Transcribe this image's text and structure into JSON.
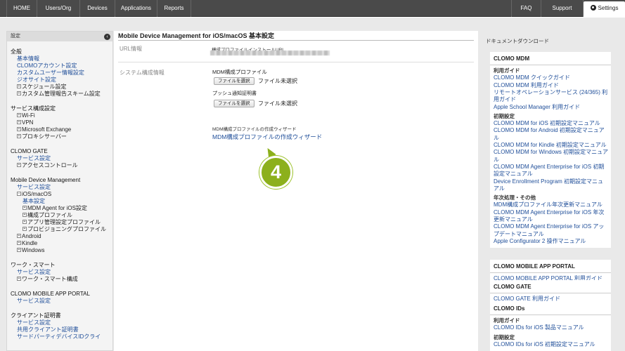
{
  "nav": {
    "items": [
      "HOME",
      "Users/Org",
      "Devices",
      "Applications",
      "Reports"
    ],
    "right_items": [
      "FAQ",
      "Support"
    ],
    "settings_label": "Settings"
  },
  "sidebar": {
    "header": "設定",
    "lines": [
      {
        "text": "全般",
        "kind": "sec",
        "indent": 0
      },
      {
        "text": "基本情報",
        "kind": "lnk",
        "indent": 1
      },
      {
        "text": "CLOMOアカウント設定",
        "kind": "lnk",
        "indent": 1
      },
      {
        "text": "カスタムユーザー情報設定",
        "kind": "lnk",
        "indent": 1
      },
      {
        "text": "ジオサイト設定",
        "kind": "lnk",
        "indent": 1
      },
      {
        "text": "スケジュール設定",
        "kind": "exp",
        "indent": 1
      },
      {
        "text": "カスタム管理報告スキーム設定",
        "kind": "exp",
        "indent": 1
      },
      {
        "text": "サービス構成設定",
        "kind": "sec",
        "indent": 0
      },
      {
        "text": "Wi-Fi",
        "kind": "exp",
        "indent": 1
      },
      {
        "text": "VPN",
        "kind": "exp",
        "indent": 1
      },
      {
        "text": "Microsoft Exchange",
        "kind": "exp",
        "indent": 1
      },
      {
        "text": "プロキシサーバー",
        "kind": "exp",
        "indent": 1
      },
      {
        "text": "CLOMO GATE",
        "kind": "sec",
        "indent": 0
      },
      {
        "text": "サービス設定",
        "kind": "lnk",
        "indent": 1
      },
      {
        "text": "アクセスコントロール",
        "kind": "exp",
        "indent": 1
      },
      {
        "text": "Mobile Device Management",
        "kind": "sec",
        "indent": 0
      },
      {
        "text": "サービス設定",
        "kind": "lnk",
        "indent": 1
      },
      {
        "text": "iOS/macOS",
        "kind": "col",
        "indent": 1
      },
      {
        "text": "基本設定",
        "kind": "lnk",
        "indent": 2
      },
      {
        "text": "MDM Agent for iOS設定",
        "kind": "exp",
        "indent": 2
      },
      {
        "text": "構成プロファイル",
        "kind": "exp",
        "indent": 2
      },
      {
        "text": "アプリ管理設定プロファイル",
        "kind": "exp",
        "indent": 2
      },
      {
        "text": "プロビジョニングプロファイル",
        "kind": "exp",
        "indent": 2
      },
      {
        "text": "Android",
        "kind": "exp",
        "indent": 1
      },
      {
        "text": "Kindle",
        "kind": "exp",
        "indent": 1
      },
      {
        "text": "Windows",
        "kind": "exp",
        "indent": 1
      },
      {
        "text": "ワーク・スマート",
        "kind": "sec",
        "indent": 0
      },
      {
        "text": "サービス設定",
        "kind": "lnk",
        "indent": 1
      },
      {
        "text": "ワーク・スマート構成",
        "kind": "exp",
        "indent": 1
      },
      {
        "text": "CLOMO MOBILE APP PORTAL",
        "kind": "sec",
        "indent": 0
      },
      {
        "text": "サービス設定",
        "kind": "lnk",
        "indent": 1
      },
      {
        "text": "クライアント証明書",
        "kind": "sec",
        "indent": 0
      },
      {
        "text": "サービス設定",
        "kind": "lnk",
        "indent": 1
      },
      {
        "text": "共用クライアント証明書",
        "kind": "lnk",
        "indent": 1
      },
      {
        "text": "サードパーティデバイスIDクライ",
        "kind": "lnk",
        "indent": 1
      }
    ]
  },
  "main": {
    "title": "Mobile Device Management for iOS/macOS 基本設定",
    "url_section_label": "URL情報",
    "url_field_label": "構成プロファイルインストールURL",
    "system_section_label": "システム構成情報",
    "mdm_profile_label": "MDM構成プロファイル",
    "push_cert_label": "プッシュ通知証明書",
    "file_button_label": "ファイルを選択",
    "file_none_label": "ファイル未選択",
    "wizard_heading": "MDM構成プロファイルの作成ウィザード",
    "wizard_link": "MDM構成プロファイルの作成ウィザード"
  },
  "callout": {
    "number": "4",
    "color": "#8cb01c"
  },
  "right": {
    "title": "ドキュメントダウンロード",
    "cards": [
      {
        "lines": [
          {
            "text": "CLOMO MDM",
            "kind": "head"
          },
          {
            "text": "利用ガイド",
            "kind": "sub"
          },
          {
            "text": "CLOMO MDM クイックガイド",
            "kind": "link"
          },
          {
            "text": "CLOMO MDM 利用ガイド",
            "kind": "link"
          },
          {
            "text": "リモートオペレーションサービス (24/365) 利",
            "kind": "link"
          },
          {
            "text": "用ガイド",
            "kind": "link"
          },
          {
            "text": "Apple School Manager 利用ガイド",
            "kind": "link"
          },
          {
            "text": "初期設定",
            "kind": "sub"
          },
          {
            "text": "CLOMO MDM for iOS 初期設定マニュアル",
            "kind": "link"
          },
          {
            "text": "CLOMO MDM for Android 初期設定マニュア",
            "kind": "link"
          },
          {
            "text": "ル",
            "kind": "link"
          },
          {
            "text": "CLOMO MDM for Kindle 初期設定マニュアル",
            "kind": "link"
          },
          {
            "text": "CLOMO MDM for Windows 初期設定マニュア",
            "kind": "link"
          },
          {
            "text": "ル",
            "kind": "link"
          },
          {
            "text": "CLOMO MDM Agent Enterprise for iOS 初期",
            "kind": "link"
          },
          {
            "text": "設定マニュアル",
            "kind": "link"
          },
          {
            "text": "Device Enrollment Program 初期設定マニュ",
            "kind": "link"
          },
          {
            "text": "アル",
            "kind": "link"
          },
          {
            "text": "年次処理・その他",
            "kind": "sub"
          },
          {
            "text": "MDM構成プロファイル年次更新マニュアル",
            "kind": "link"
          },
          {
            "text": "CLOMO MDM Agent Enterprise for iOS 年次",
            "kind": "link"
          },
          {
            "text": "更新マニュアル",
            "kind": "link"
          },
          {
            "text": "CLOMO MDM Agent Enterprise for iOS アッ",
            "kind": "link"
          },
          {
            "text": "プデートマニュアル",
            "kind": "link"
          },
          {
            "text": "Apple Configurator 2 操作マニュアル",
            "kind": "link"
          }
        ]
      },
      {
        "lines": [
          {
            "text": "CLOMO MOBILE APP PORTAL",
            "kind": "head"
          },
          {
            "text": "CLOMO MOBILE APP PORTAL 利用ガイド",
            "kind": "link"
          }
        ]
      },
      {
        "lines": [
          {
            "text": "CLOMO GATE",
            "kind": "head"
          },
          {
            "text": "CLOMO GATE 利用ガイド",
            "kind": "link"
          }
        ]
      },
      {
        "lines": [
          {
            "text": "CLOMO IDs",
            "kind": "head"
          },
          {
            "text": "利用ガイド",
            "kind": "sub"
          },
          {
            "text": "CLOMO IDs for iOS 製品マニュアル",
            "kind": "link"
          },
          {
            "text": "初期設定",
            "kind": "sub"
          },
          {
            "text": "CLOMO IDs for iOS 初期設定マニュアル",
            "kind": "link"
          }
        ]
      }
    ]
  }
}
